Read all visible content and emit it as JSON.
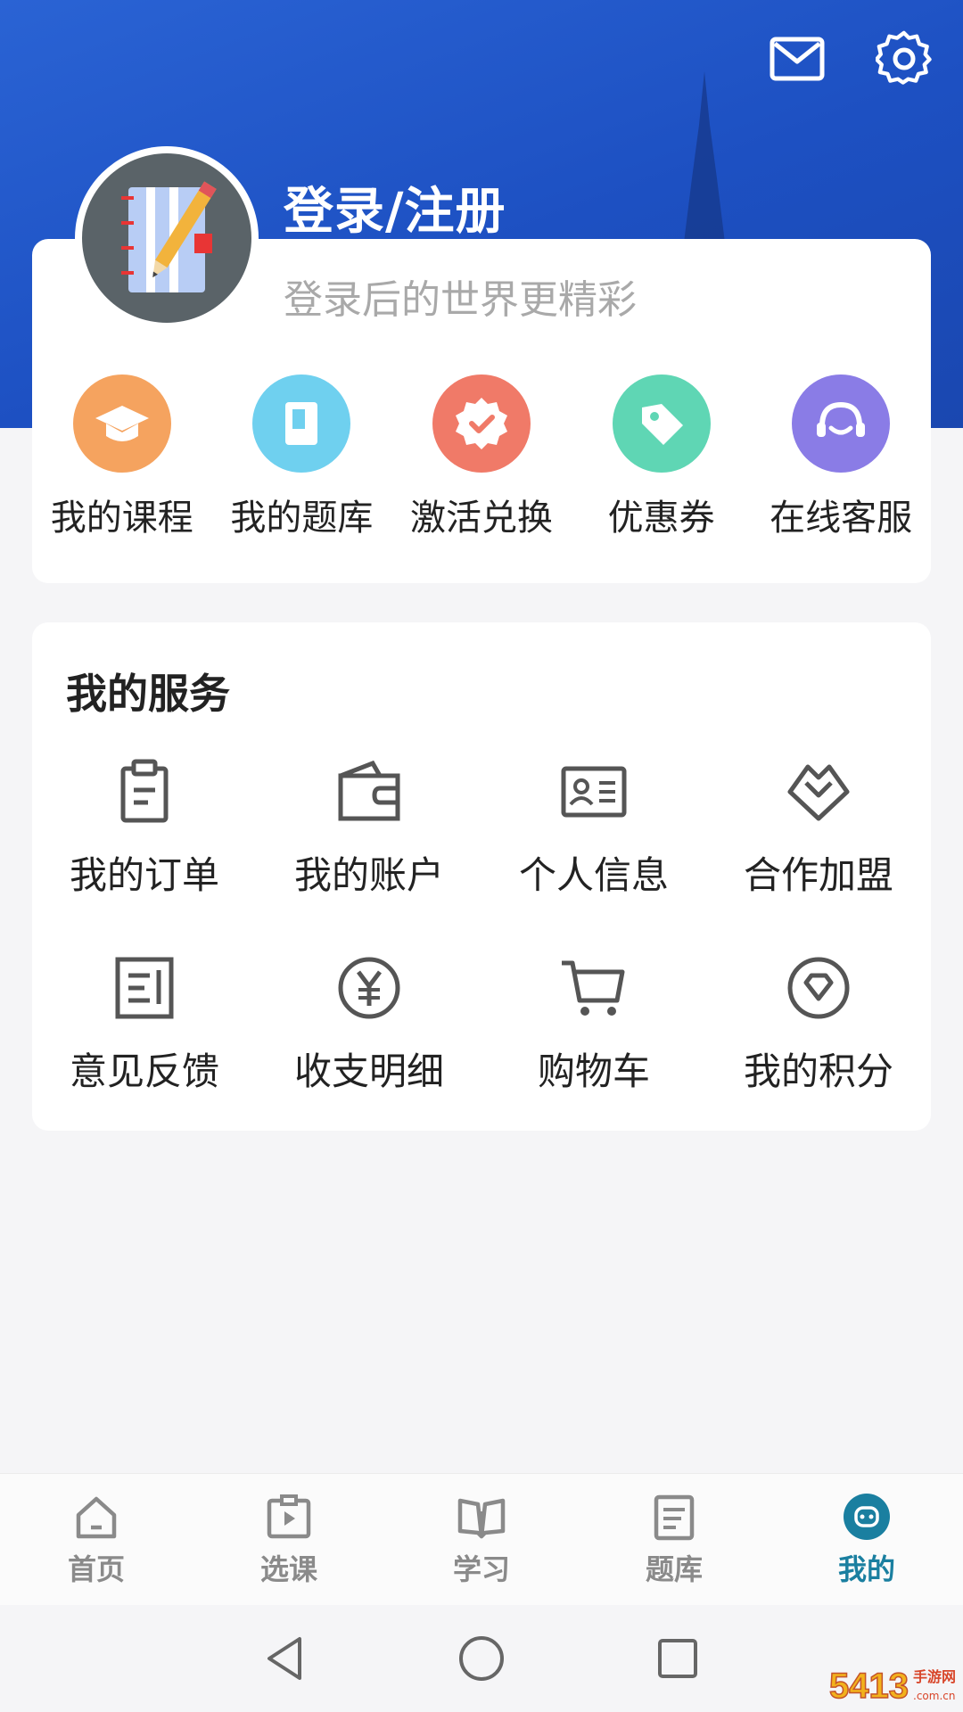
{
  "header": {
    "mail_icon": "mail-icon",
    "settings_icon": "gear-icon"
  },
  "profile": {
    "title": "登录/注册",
    "subtitle": "登录后的世界更精彩"
  },
  "quick_actions": [
    {
      "label": "我的课程",
      "icon": "graduation-cap-icon",
      "color": "#f5a35f"
    },
    {
      "label": "我的题库",
      "icon": "book-icon",
      "color": "#6fd0ef"
    },
    {
      "label": "激活兑换",
      "icon": "badge-check-icon",
      "color": "#f07a68"
    },
    {
      "label": "优惠券",
      "icon": "tag-icon",
      "color": "#5fd6b4"
    },
    {
      "label": "在线客服",
      "icon": "headset-icon",
      "color": "#8a7ce6"
    }
  ],
  "services": {
    "title": "我的服务",
    "items": [
      {
        "label": "我的订单",
        "icon": "clipboard-icon"
      },
      {
        "label": "我的账户",
        "icon": "wallet-icon"
      },
      {
        "label": "个人信息",
        "icon": "id-card-icon"
      },
      {
        "label": "合作加盟",
        "icon": "handshake-icon"
      },
      {
        "label": "意见反馈",
        "icon": "feedback-icon"
      },
      {
        "label": "收支明细",
        "icon": "yen-icon"
      },
      {
        "label": "购物车",
        "icon": "cart-icon"
      },
      {
        "label": "我的积分",
        "icon": "diamond-icon"
      }
    ]
  },
  "tabbar": {
    "items": [
      {
        "label": "首页",
        "icon": "home-icon"
      },
      {
        "label": "选课",
        "icon": "video-clipboard-icon"
      },
      {
        "label": "学习",
        "icon": "open-book-icon"
      },
      {
        "label": "题库",
        "icon": "document-icon"
      },
      {
        "label": "我的",
        "icon": "profile-face-icon",
        "active": true
      }
    ],
    "active_color": "#1a7fa0"
  },
  "watermark": {
    "text": "5413手游网"
  }
}
